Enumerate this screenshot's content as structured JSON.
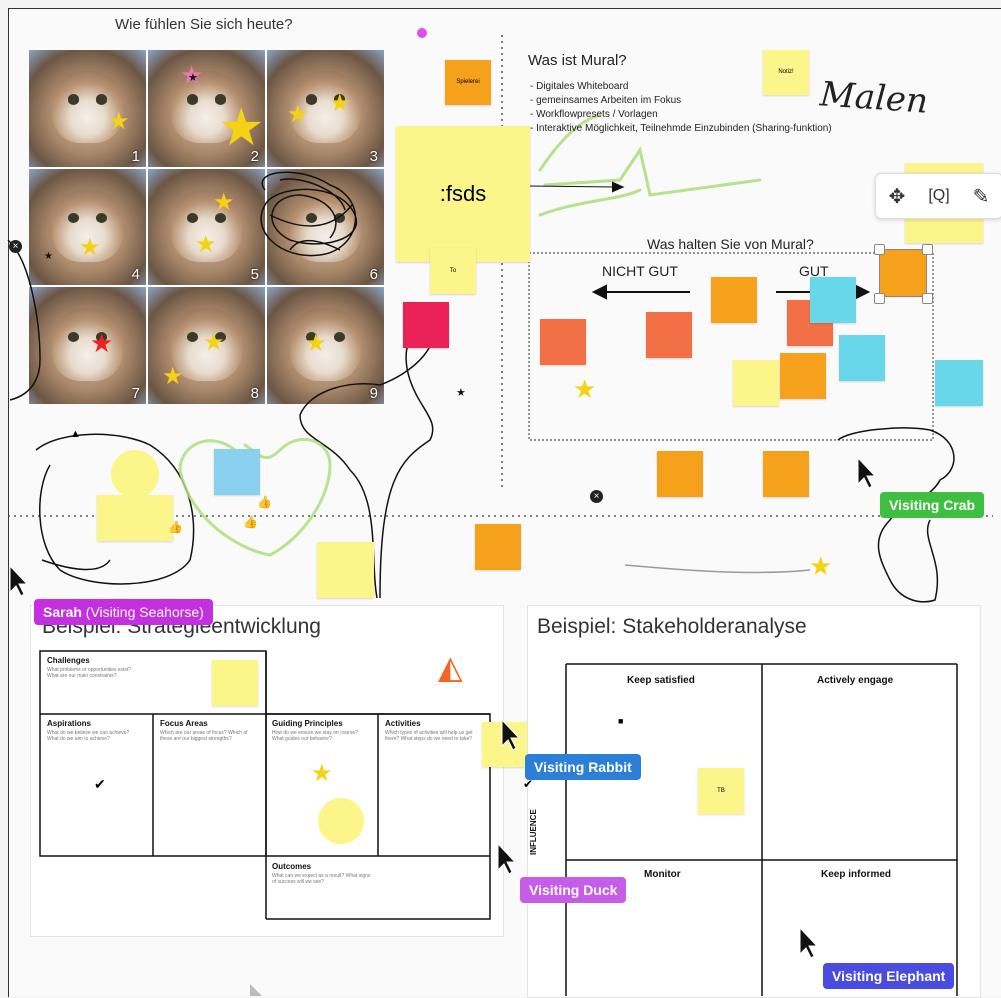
{
  "board": {
    "question_top": "Wie fühlen Sie sich heute?",
    "mural_title": "Was ist Mural?",
    "mural_bullets": [
      "- Digitales Whiteboard",
      "- gemeinsames Arbeiten im Fokus",
      "- Workflowpresets  / Vorlagen",
      "- Interaktive Möglichkeit, Teilnehmde Einzubinden (Sharing-funktion)"
    ],
    "handwriting": "Malen",
    "fsds": ":fsds",
    "sticky_spielerei": "Spielerei",
    "sticky_notiz": "Notiz!",
    "sticky_to": "To",
    "opinion_title": "Was halten Sie von Mural?",
    "nicht_gut": "NICHT GUT",
    "gut": "GUT",
    "cat_numbers": [
      "1",
      "2",
      "3",
      "4",
      "5",
      "6",
      "7",
      "8",
      "9"
    ]
  },
  "strategy": {
    "title": "Beispiel: Strategieentwicklung",
    "challenges": "Challenges",
    "challenges_text": "What problems or opportunities exist? What are our main constraints?",
    "aspirations": "Aspirations",
    "aspirations_text": "What do we believe we can achieve? What do we aim to achieve?",
    "focus_areas": "Focus Areas",
    "focus_text": "Which are our areas of focus? Which of these are our biggest strengths?",
    "guiding": "Guiding Principles",
    "guiding_text": "How do we ensure we stay on course? What guides our behavior?",
    "activities": "Activities",
    "activities_text": "Which types of activities will help us get there? What steps do we need to take?",
    "outcomes": "Outcomes",
    "outcomes_text": "What can we expect as a result? What signs of success will we see?"
  },
  "stakeholder": {
    "title": "Beispiel: Stakeholderanalyse",
    "q1": "Keep satisfied",
    "q2": "Actively engage",
    "q3": "Monitor",
    "q4": "Keep informed",
    "axis": "INFLUENCE",
    "sticky_tb": "TB"
  },
  "cursors": {
    "sarah_name": "Sarah",
    "sarah_role": " (Visiting Seahorse)",
    "crab": "Visiting Crab",
    "rabbit": "Visiting Rabbit",
    "duck": "Visiting Duck",
    "elephant": "Visiting Elephant"
  },
  "colors": {
    "sticky_yellow": "#fbf58a",
    "sticky_orange": "#f6a11c",
    "sticky_red": "#f37046",
    "sticky_pink": "#ea2157",
    "sticky_cyan": "#68d7ea",
    "badge_seahorse": "#c430e0",
    "badge_crab": "#3fbf3f",
    "badge_rabbit": "#2b7fd6",
    "badge_duck": "#c55de8",
    "badge_elephant": "#4a4ce0"
  }
}
